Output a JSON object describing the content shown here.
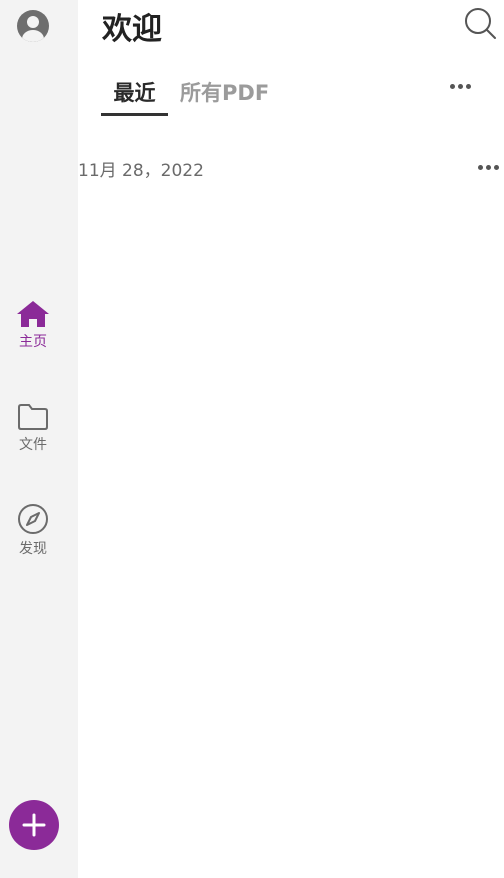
{
  "header": {
    "title": "欢迎"
  },
  "tabs": [
    {
      "label": "最近",
      "active": true
    },
    {
      "label": "所有PDF",
      "active": false
    }
  ],
  "recent": {
    "date_group": "11月 28，2022"
  },
  "sidebar": {
    "items": [
      {
        "label": "主页",
        "icon": "home-icon",
        "active": true
      },
      {
        "label": "文件",
        "icon": "folder-icon",
        "active": false
      },
      {
        "label": "发现",
        "icon": "compass-icon",
        "active": false
      }
    ]
  },
  "fab": {
    "icon": "plus-icon"
  },
  "colors": {
    "accent": "#8b2a98",
    "rail_bg": "#f3f3f3",
    "text_dark": "#222222",
    "text_muted": "#9b9b9b"
  }
}
